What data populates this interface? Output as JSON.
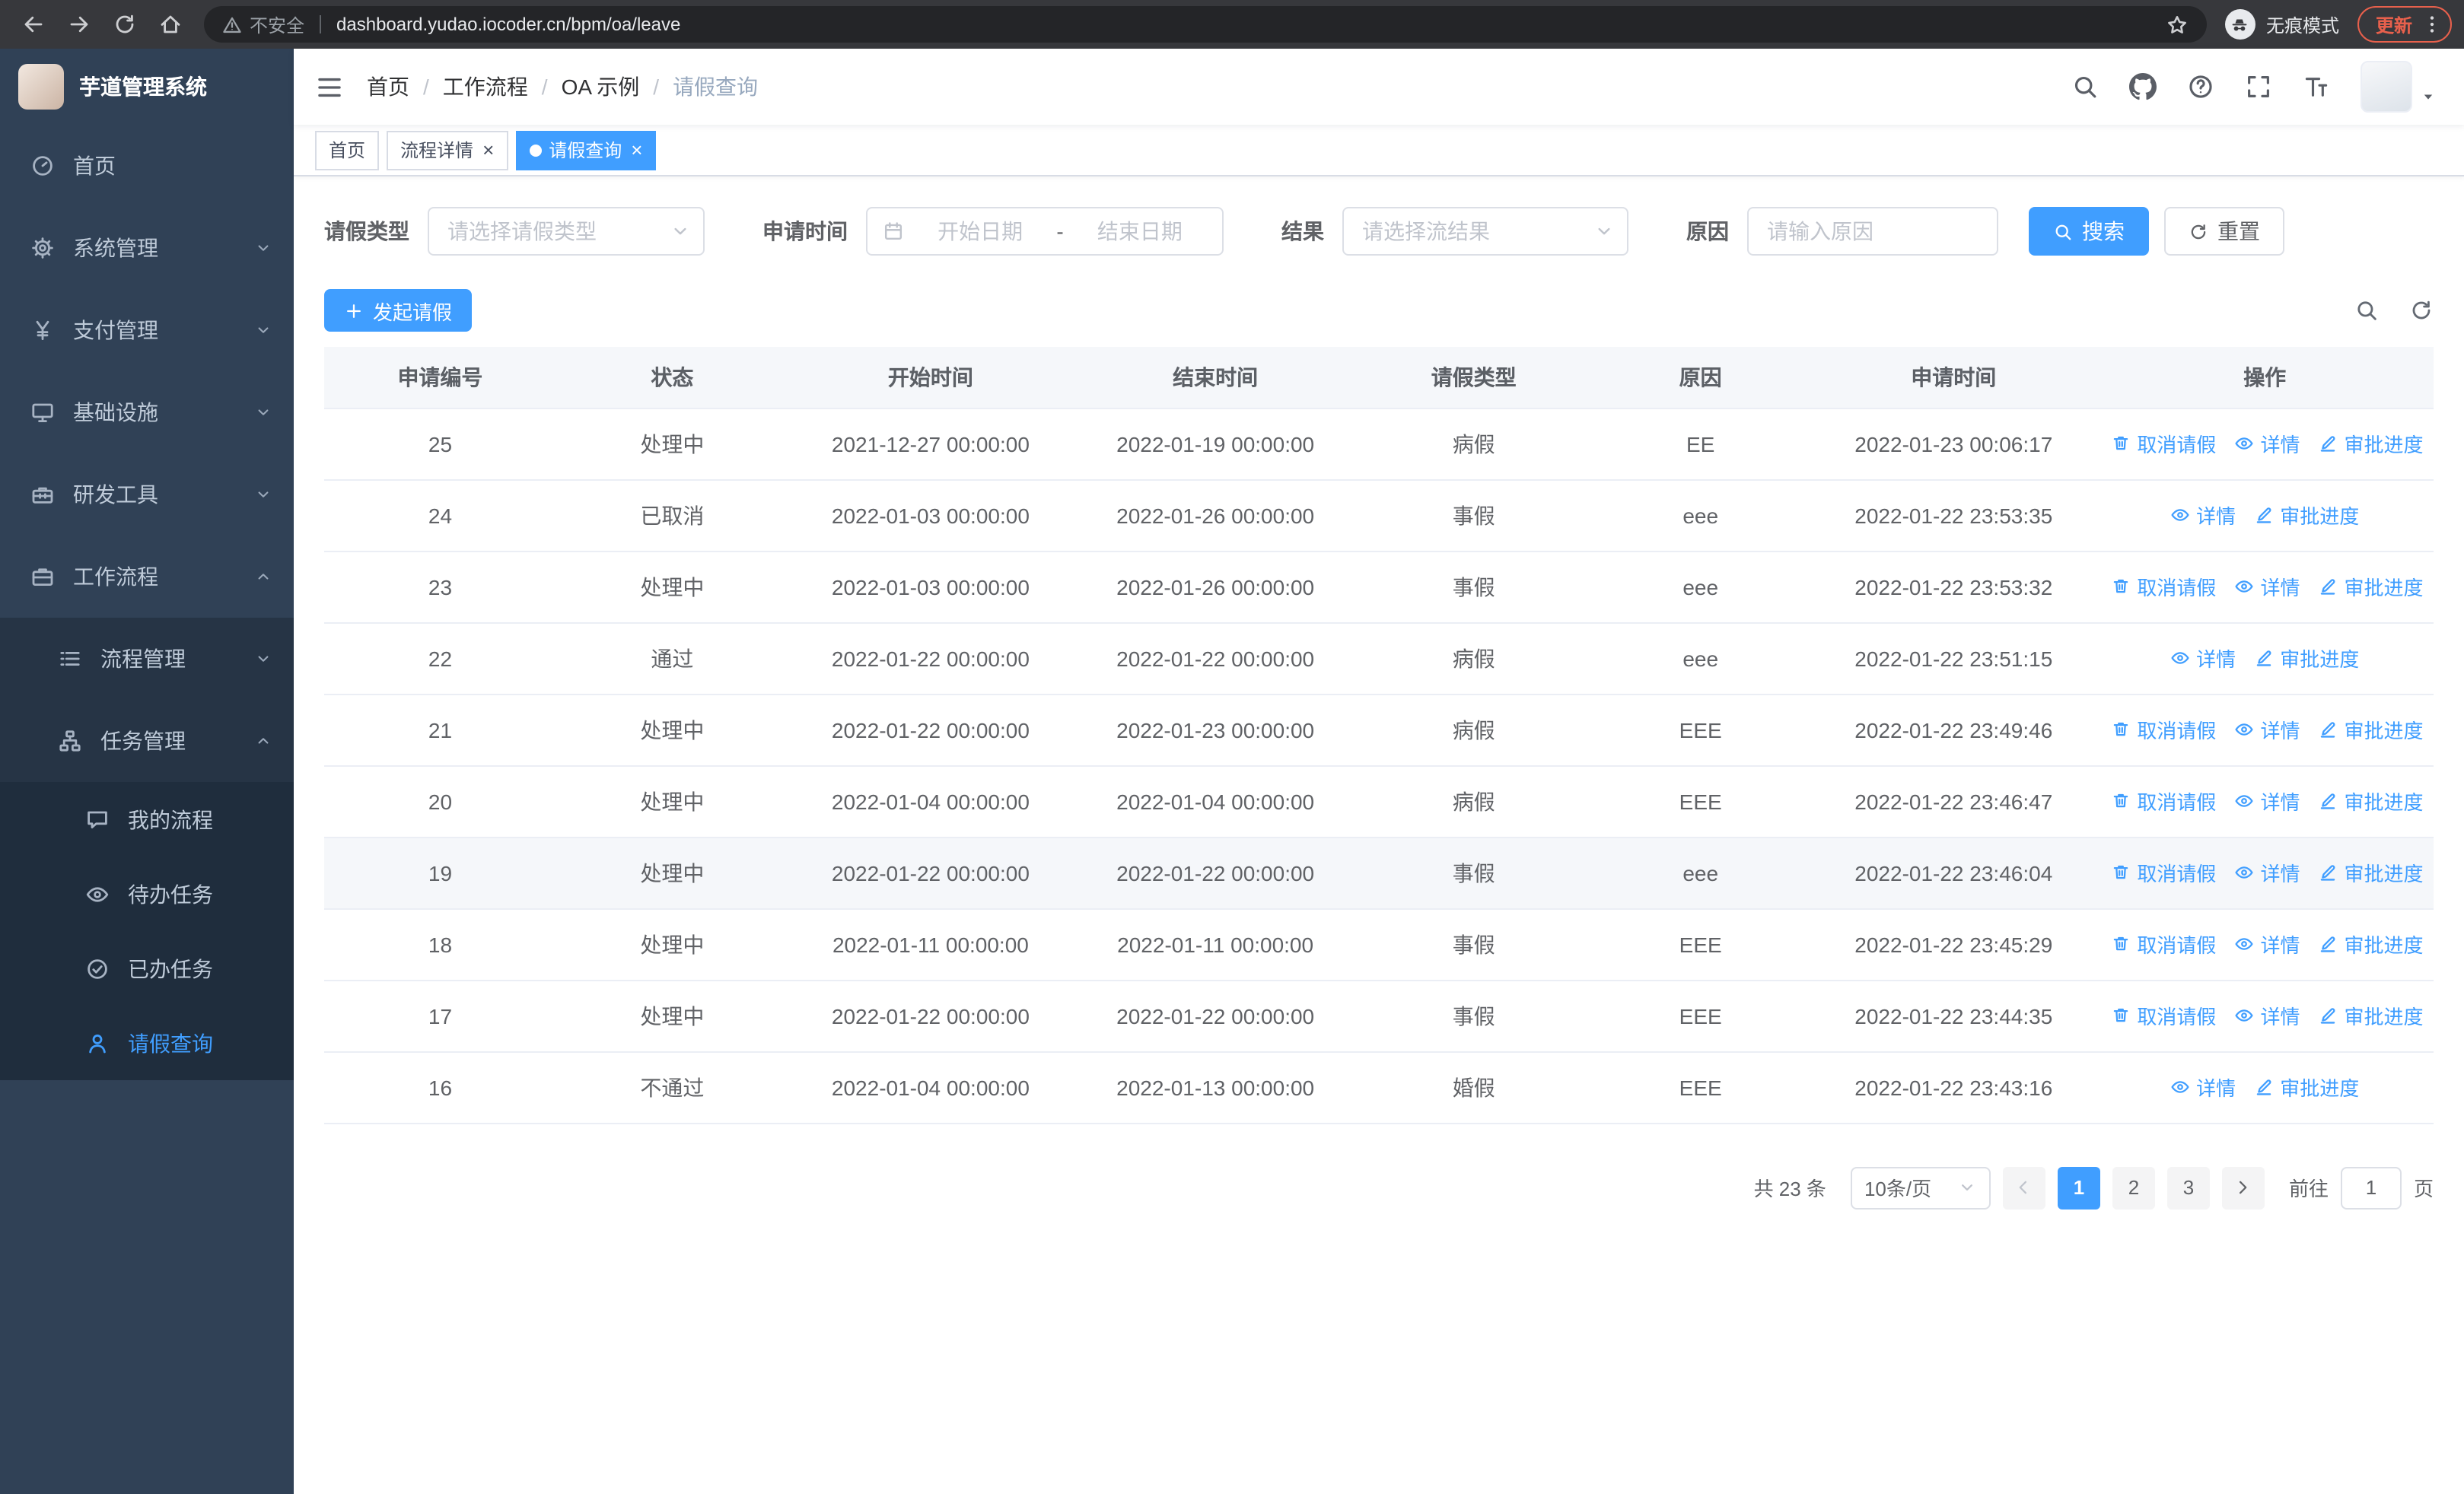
{
  "colors": {
    "accent": "#409eff",
    "sidebar_bg": "#304156",
    "sidebar_sub_bg": "#263445",
    "sidebar_leaf_bg": "#1f2d3d",
    "chrome_bg": "#37383c",
    "update_accent": "#e8604c"
  },
  "icons": {
    "close": "×",
    "breadcrumb_separator": "/"
  },
  "browser": {
    "security_label": "不安全",
    "url": "dashboard.yudao.iocoder.cn/bpm/oa/leave",
    "incognito_label": "无痕模式",
    "update_label": "更新"
  },
  "sidebar": {
    "logo_title": "芋道管理系统",
    "items": [
      {
        "label": "首页",
        "icon": "dashboard-icon"
      },
      {
        "label": "系统管理",
        "icon": "gear-icon",
        "state": "collapsed"
      },
      {
        "label": "支付管理",
        "icon": "yen-icon",
        "state": "collapsed"
      },
      {
        "label": "基础设施",
        "icon": "monitor-icon",
        "state": "collapsed"
      },
      {
        "label": "研发工具",
        "icon": "toolbox-icon",
        "state": "collapsed"
      },
      {
        "label": "工作流程",
        "icon": "briefcase-icon",
        "state": "expanded"
      }
    ],
    "workflow_children": [
      {
        "label": "流程管理",
        "icon": "list-icon",
        "state": "collapsed"
      },
      {
        "label": "任务管理",
        "icon": "org-icon",
        "state": "expanded"
      }
    ],
    "task_children": [
      {
        "label": "我的流程",
        "icon": "chat-icon"
      },
      {
        "label": "待办任务",
        "icon": "eye-icon"
      },
      {
        "label": "已办任务",
        "icon": "check-circle-icon"
      },
      {
        "label": "请假查询",
        "icon": "user-icon",
        "active": true
      }
    ]
  },
  "header": {
    "breadcrumb": [
      "首页",
      "工作流程",
      "OA 示例",
      "请假查询"
    ]
  },
  "tabs": [
    {
      "label": "首页",
      "closable": false,
      "active": false
    },
    {
      "label": "流程详情",
      "closable": true,
      "active": false
    },
    {
      "label": "请假查询",
      "closable": true,
      "active": true
    }
  ],
  "filters": {
    "leave_type_label": "请假类型",
    "leave_type_placeholder": "请选择请假类型",
    "apply_time_label": "申请时间",
    "start_placeholder": "开始日期",
    "range_separator": "-",
    "end_placeholder": "结束日期",
    "result_label": "结果",
    "result_placeholder": "请选择流结果",
    "reason_label": "原因",
    "reason_placeholder": "请输入原因",
    "search_label": "搜索",
    "reset_label": "重置"
  },
  "toolbar": {
    "create_label": "发起请假"
  },
  "table": {
    "headers": [
      "申请编号",
      "状态",
      "开始时间",
      "结束时间",
      "请假类型",
      "原因",
      "申请时间",
      "操作"
    ],
    "action_defs": {
      "cancel": {
        "label": "取消请假",
        "icon": "delete-icon"
      },
      "detail": {
        "label": "详情",
        "icon": "view-icon"
      },
      "progress": {
        "label": "审批进度",
        "icon": "edit-icon"
      }
    },
    "rows": [
      {
        "id": "25",
        "status": "处理中",
        "start": "2021-12-27 00:00:00",
        "end": "2022-01-19 00:00:00",
        "type": "病假",
        "reason": "EE",
        "applied": "2022-01-23 00:06:17",
        "actions": [
          "cancel",
          "detail",
          "progress"
        ]
      },
      {
        "id": "24",
        "status": "已取消",
        "start": "2022-01-03 00:00:00",
        "end": "2022-01-26 00:00:00",
        "type": "事假",
        "reason": "eee",
        "applied": "2022-01-22 23:53:35",
        "actions": [
          "detail",
          "progress"
        ]
      },
      {
        "id": "23",
        "status": "处理中",
        "start": "2022-01-03 00:00:00",
        "end": "2022-01-26 00:00:00",
        "type": "事假",
        "reason": "eee",
        "applied": "2022-01-22 23:53:32",
        "actions": [
          "cancel",
          "detail",
          "progress"
        ]
      },
      {
        "id": "22",
        "status": "通过",
        "start": "2022-01-22 00:00:00",
        "end": "2022-01-22 00:00:00",
        "type": "病假",
        "reason": "eee",
        "applied": "2022-01-22 23:51:15",
        "actions": [
          "detail",
          "progress"
        ]
      },
      {
        "id": "21",
        "status": "处理中",
        "start": "2022-01-22 00:00:00",
        "end": "2022-01-23 00:00:00",
        "type": "病假",
        "reason": "EEE",
        "applied": "2022-01-22 23:49:46",
        "actions": [
          "cancel",
          "detail",
          "progress"
        ]
      },
      {
        "id": "20",
        "status": "处理中",
        "start": "2022-01-04 00:00:00",
        "end": "2022-01-04 00:00:00",
        "type": "病假",
        "reason": "EEE",
        "applied": "2022-01-22 23:46:47",
        "actions": [
          "cancel",
          "detail",
          "progress"
        ]
      },
      {
        "id": "19",
        "status": "处理中",
        "start": "2022-01-22 00:00:00",
        "end": "2022-01-22 00:00:00",
        "type": "事假",
        "reason": "eee",
        "applied": "2022-01-22 23:46:04",
        "actions": [
          "cancel",
          "detail",
          "progress"
        ],
        "hover": true
      },
      {
        "id": "18",
        "status": "处理中",
        "start": "2022-01-11 00:00:00",
        "end": "2022-01-11 00:00:00",
        "type": "事假",
        "reason": "EEE",
        "applied": "2022-01-22 23:45:29",
        "actions": [
          "cancel",
          "detail",
          "progress"
        ]
      },
      {
        "id": "17",
        "status": "处理中",
        "start": "2022-01-22 00:00:00",
        "end": "2022-01-22 00:00:00",
        "type": "事假",
        "reason": "EEE",
        "applied": "2022-01-22 23:44:35",
        "actions": [
          "cancel",
          "detail",
          "progress"
        ]
      },
      {
        "id": "16",
        "status": "不通过",
        "start": "2022-01-04 00:00:00",
        "end": "2022-01-13 00:00:00",
        "type": "婚假",
        "reason": "EEE",
        "applied": "2022-01-22 23:43:16",
        "actions": [
          "detail",
          "progress"
        ]
      }
    ]
  },
  "pagination": {
    "total_text": "共 23 条",
    "page_size_label": "10条/页",
    "pages": [
      "1",
      "2",
      "3"
    ],
    "current_page": "1",
    "goto_prefix": "前往",
    "goto_value": "1",
    "goto_suffix": "页"
  }
}
